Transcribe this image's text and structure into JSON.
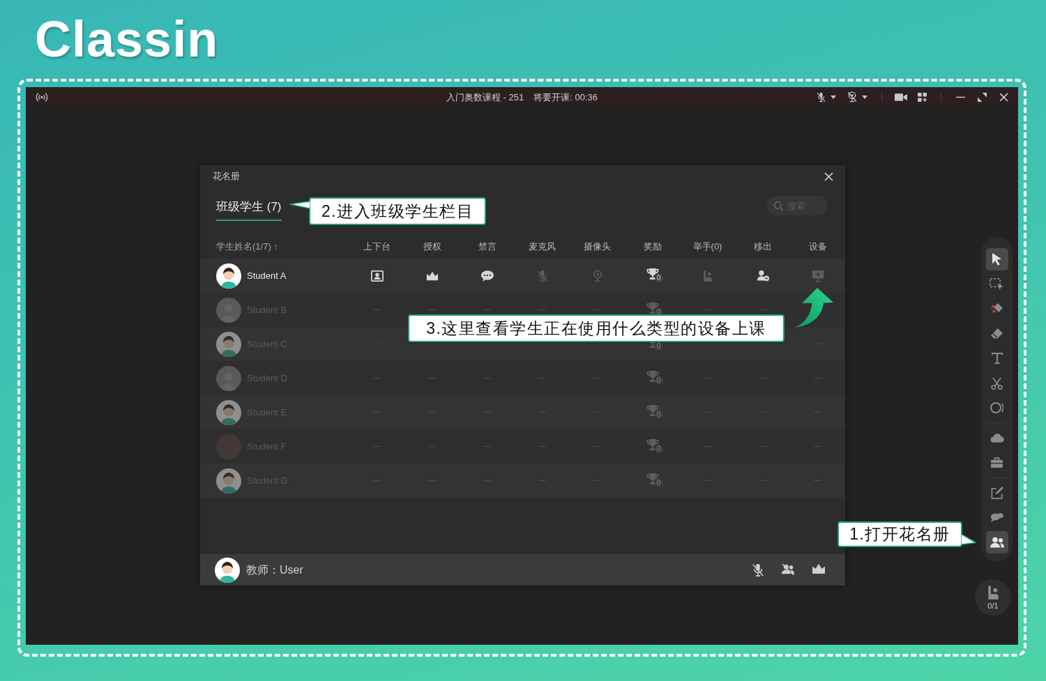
{
  "logo": {
    "text": "Classin"
  },
  "window": {
    "course": "入门奥数课程 - 251",
    "countdown": "将要开课: 00:36"
  },
  "roster": {
    "title": "花名册",
    "tabs": [
      {
        "label": "班级学生 (7)",
        "selected": true
      }
    ],
    "search": {
      "placeholder": "搜索"
    },
    "columns": [
      "学生姓名(1/7) ↑",
      "上下台",
      "授权",
      "禁言",
      "麦克风",
      "摄像头",
      "奖励",
      "举手(0)",
      "移出",
      "设备"
    ],
    "rows": [
      {
        "name": "Student A",
        "online": true,
        "avatar": {
          "kind": "illustrated"
        },
        "cells": [
          {
            "kind": "stage",
            "enabled": true
          },
          {
            "kind": "crown",
            "enabled": true
          },
          {
            "kind": "chat",
            "enabled": true
          },
          {
            "kind": "mic",
            "enabled": false
          },
          {
            "kind": "camera",
            "enabled": false
          },
          {
            "kind": "trophy",
            "enabled": true,
            "count": "0"
          },
          {
            "kind": "hand",
            "enabled": false
          },
          {
            "kind": "remove",
            "enabled": true
          },
          {
            "kind": "device",
            "enabled": false
          }
        ]
      },
      {
        "name": "Student B",
        "online": false,
        "avatar": {
          "kind": "default"
        },
        "cells": [
          {
            "kind": "dash"
          },
          {
            "kind": "dash"
          },
          {
            "kind": "dash"
          },
          {
            "kind": "dash"
          },
          {
            "kind": "dash"
          },
          {
            "kind": "trophy",
            "enabled": false,
            "count": "0"
          },
          {
            "kind": "dash"
          },
          {
            "kind": "dash"
          },
          {
            "kind": "blank"
          }
        ]
      },
      {
        "name": "Student C",
        "online": false,
        "avatar": {
          "kind": "illustrated"
        },
        "cells": [
          {
            "kind": "dash"
          },
          {
            "kind": "blank"
          },
          {
            "kind": "blank"
          },
          {
            "kind": "blank"
          },
          {
            "kind": "blank"
          },
          {
            "kind": "trophy",
            "enabled": false,
            "count": "0"
          },
          {
            "kind": "blank"
          },
          {
            "kind": "blank"
          },
          {
            "kind": "dash"
          }
        ]
      },
      {
        "name": "Student D",
        "online": false,
        "avatar": {
          "kind": "default"
        },
        "cells": [
          {
            "kind": "dash"
          },
          {
            "kind": "dash"
          },
          {
            "kind": "dash"
          },
          {
            "kind": "dash"
          },
          {
            "kind": "dash"
          },
          {
            "kind": "trophy",
            "enabled": false,
            "count": "0"
          },
          {
            "kind": "dash"
          },
          {
            "kind": "dash"
          },
          {
            "kind": "dash"
          }
        ]
      },
      {
        "name": "Student E",
        "online": false,
        "avatar": {
          "kind": "illustrated"
        },
        "cells": [
          {
            "kind": "dash"
          },
          {
            "kind": "dash"
          },
          {
            "kind": "dash"
          },
          {
            "kind": "dash"
          },
          {
            "kind": "dash"
          },
          {
            "kind": "trophy",
            "enabled": false,
            "count": "0"
          },
          {
            "kind": "dash"
          },
          {
            "kind": "dash"
          },
          {
            "kind": "dash"
          }
        ]
      },
      {
        "name": "Student F",
        "online": false,
        "avatar": {
          "kind": "photo"
        },
        "cells": [
          {
            "kind": "dash"
          },
          {
            "kind": "dash"
          },
          {
            "kind": "dash"
          },
          {
            "kind": "dash"
          },
          {
            "kind": "dash"
          },
          {
            "kind": "trophy",
            "enabled": false,
            "count": "0"
          },
          {
            "kind": "dash"
          },
          {
            "kind": "dash"
          },
          {
            "kind": "dash"
          }
        ]
      },
      {
        "name": "Student G",
        "online": false,
        "avatar": {
          "kind": "illustrated"
        },
        "cells": [
          {
            "kind": "dash"
          },
          {
            "kind": "dash"
          },
          {
            "kind": "dash"
          },
          {
            "kind": "dash"
          },
          {
            "kind": "dash"
          },
          {
            "kind": "trophy",
            "enabled": false,
            "count": "0"
          },
          {
            "kind": "dash"
          },
          {
            "kind": "dash"
          },
          {
            "kind": "dash"
          }
        ]
      }
    ],
    "teacher": {
      "label": "教师：User",
      "avatar": {
        "kind": "illustrated"
      }
    }
  },
  "toolbar": {
    "tool_groups": [
      [
        {
          "kind": "pointer",
          "selected": true
        },
        {
          "kind": "marquee",
          "selected": false
        },
        {
          "kind": "laser",
          "selected": false
        },
        {
          "kind": "eraser",
          "selected": false
        },
        {
          "kind": "text",
          "selected": false
        },
        {
          "kind": "scissors",
          "selected": false
        },
        {
          "kind": "shape",
          "selected": false
        }
      ],
      [
        {
          "kind": "cloud",
          "selected": false
        },
        {
          "kind": "toolbox",
          "selected": false
        }
      ],
      [
        {
          "kind": "edit",
          "selected": false
        },
        {
          "kind": "chats",
          "selected": false
        },
        {
          "kind": "roster",
          "selected": true
        }
      ]
    ],
    "hand_counter": "0/1"
  },
  "annotations": [
    {
      "kind": "pointer-left",
      "text": "2.进入班级学生栏目"
    },
    {
      "kind": "arrow",
      "text": "3.这里查看学生正在使用什么类型的设备上课"
    },
    {
      "kind": "pointer-right",
      "text": "1.打开花名册"
    }
  ]
}
